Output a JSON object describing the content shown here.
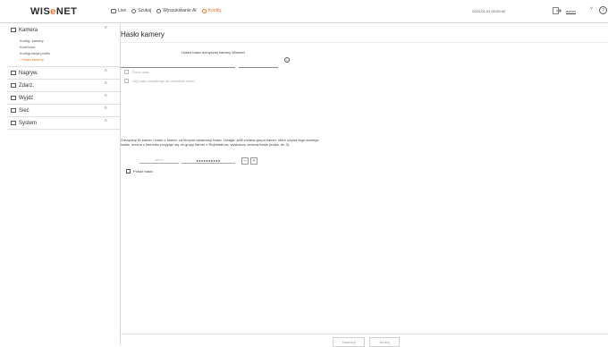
{
  "brand": {
    "logo_prefix": "WIS",
    "logo_o": "e",
    "logo_suffix": "NET"
  },
  "topnav": [
    {
      "label": "Live",
      "icon": "monitor-icon"
    },
    {
      "label": "Szukaj",
      "icon": "search-icon"
    },
    {
      "label": "Wyszukiwanie AI",
      "icon": "ai-search-icon"
    },
    {
      "label": "Konfig.",
      "icon": "settings-icon",
      "active": true
    }
  ],
  "header": {
    "datetime": "2023-01-01 00:00:00",
    "user": "admin",
    "help": "?"
  },
  "sidebar": {
    "groups": [
      {
        "label": "Kamera",
        "icon": "camera-icon",
        "expanded": true,
        "items": [
          {
            "label": "Konfig. kamery"
          },
          {
            "label": "Konf.kam."
          },
          {
            "label": "Konfiguracja profilu"
          },
          {
            "label": "Hasło kamery",
            "active": true
          }
        ]
      },
      {
        "label": "Nagryw.",
        "icon": "record-icon"
      },
      {
        "label": "Zdarz.",
        "icon": "event-icon"
      },
      {
        "label": "Wyjdź",
        "icon": "exit-icon"
      },
      {
        "label": "Sieć",
        "icon": "network-icon"
      },
      {
        "label": "System",
        "icon": "system-icon"
      }
    ]
  },
  "main": {
    "title": "Hasło kamery",
    "default_pw_label": "Ustaw hasło domyślnej kamery Wisenet",
    "confirm_placeholder": "",
    "info": "i",
    "show_password_top": "Pokaż hasło",
    "apply_all_label": "Użyj hasła domyślnego dla wszystkich kamer",
    "description": "Zarządzaj ID kamer i hasło z kamer, za którymi ustawiony hasło. Uwaga: jeśli zmiana grupa kamer, które używa tego samego hasła, można z kierunku przypiąć się do grupy kamer z Rejestratora, wystarczy zmiana hasła (maks. do 3).",
    "group_placeholder": "admin",
    "group_password": "●●●●●●●●●●",
    "minus": "–",
    "plus": "+",
    "show_password_bottom": "Pokaż hasło",
    "apply_button": "Zastosuj",
    "cancel_button": "Anuluj"
  }
}
